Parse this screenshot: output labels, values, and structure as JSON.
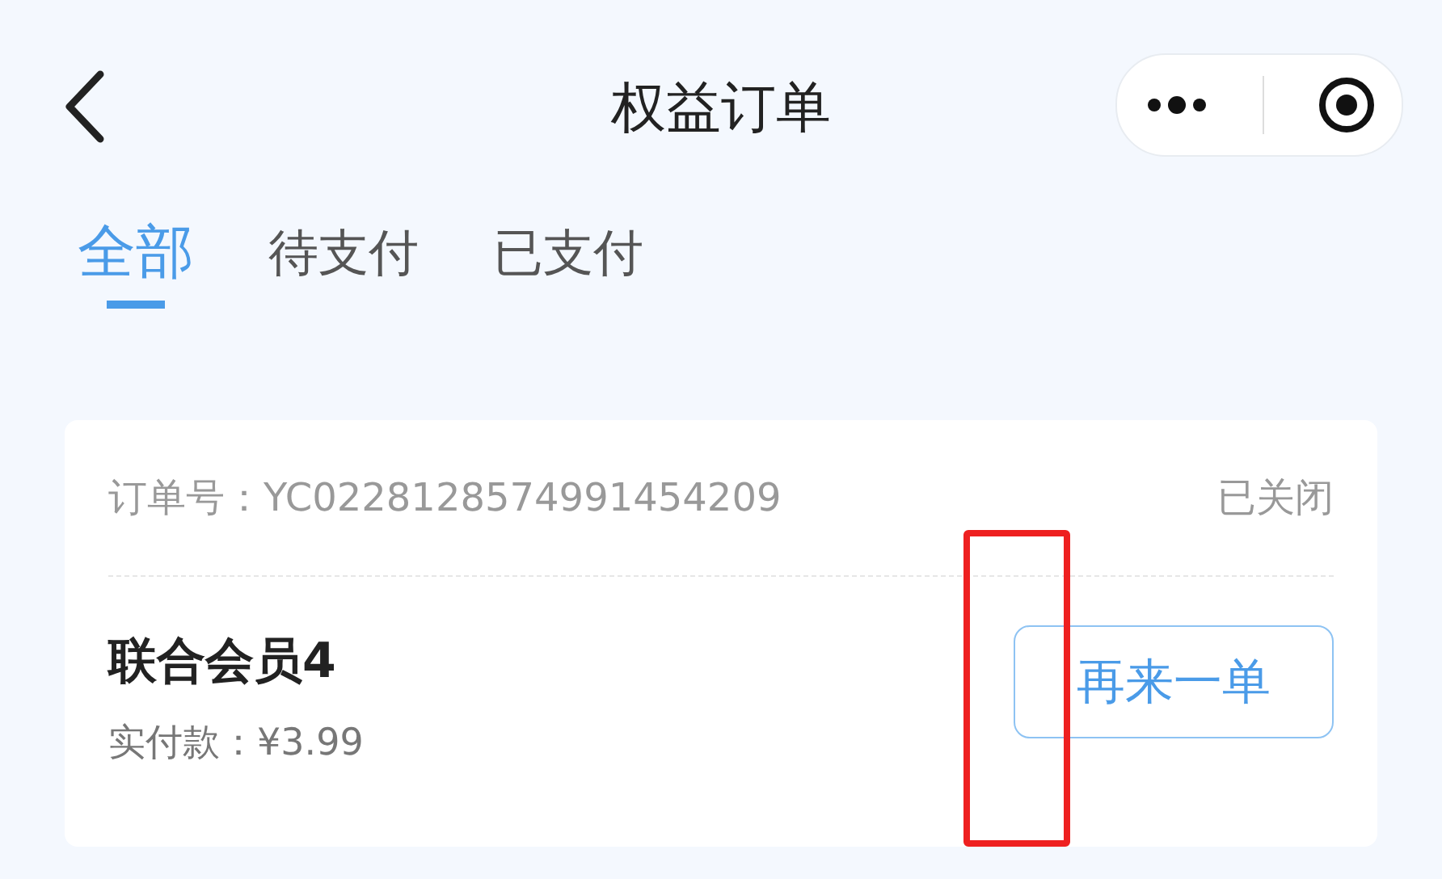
{
  "nav": {
    "title": "权益订单"
  },
  "tabs": [
    {
      "label": "全部",
      "selected": true
    },
    {
      "label": "待支付",
      "selected": false
    },
    {
      "label": "已支付",
      "selected": false
    }
  ],
  "orders": [
    {
      "order_label": "订单号：YC0228128574991454209",
      "status": "已关闭",
      "product": "联合会员4",
      "paid": "实付款：¥3.99",
      "action": "再来一单",
      "highlight": {
        "color": "#ee2020"
      }
    }
  ]
}
